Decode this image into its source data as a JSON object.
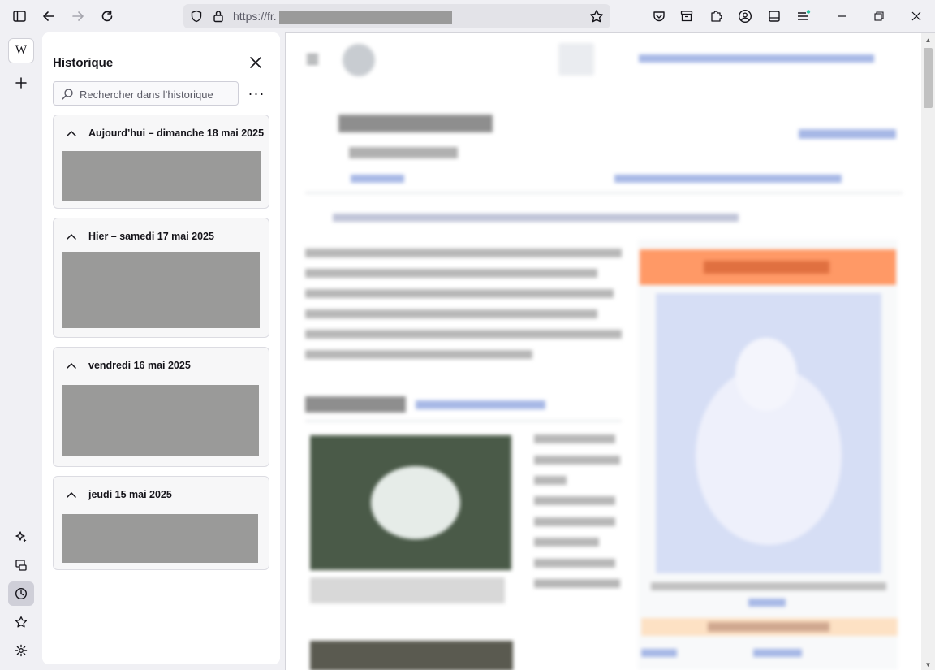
{
  "browser": {
    "url": "https://fr.",
    "icons": {
      "sidebar_toggle": "sidebar-toggle-icon",
      "back": "back-arrow-icon",
      "forward": "forward-arrow-icon",
      "reload": "reload-icon",
      "shield": "shield-icon",
      "lock": "lock-icon",
      "star": "bookmark-star-icon",
      "pocket": "pocket-icon",
      "archive": "archive-icon",
      "extensions": "puzzle-icon",
      "account": "account-icon",
      "reader": "reader-view-icon",
      "menu": "hamburger-menu-icon"
    }
  },
  "sidebar_rail": {
    "wiki_tile": "W"
  },
  "history": {
    "title": "Historique",
    "search_placeholder": "Rechercher dans l’historique",
    "more_label": "···",
    "groups": [
      {
        "label": "Aujourd’hui – dimanche 18 mai 2025"
      },
      {
        "label": "Hier – samedi 17 mai 2025"
      },
      {
        "label": "vendredi 16 mai 2025"
      },
      {
        "label": "jeudi 15 mai 2025"
      }
    ]
  },
  "page": {
    "site_name": "Wikipédia",
    "site_tagline": "L'encyclopédie libre",
    "article_title": "Renard polaire",
    "article_subtitle": "Vulpes lagopus",
    "infobox_title": "Vulpes lagopus",
    "section_heading": "Répartition",
    "classification_heading": "Classification MSW",
    "accent": "#3366cc",
    "infobox_color": "#ff9966"
  }
}
